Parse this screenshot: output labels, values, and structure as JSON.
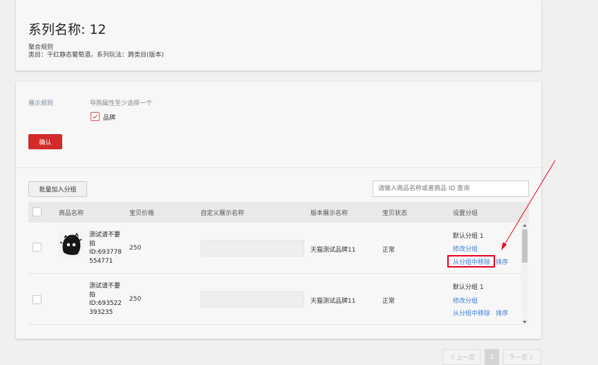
{
  "header": {
    "title": "系列名称: 12",
    "rule_title": "聚合规则",
    "rule_desc": "类目：干红静态葡萄酒，系列玩法：跨类目(版本)"
  },
  "display_rules": {
    "label": "展示规则",
    "hint": "导购属性至少选择一个",
    "brand_option": "品牌",
    "brand_checked": true,
    "confirm_label": "确认"
  },
  "toolbar": {
    "batch_add_label": "批量加入分组",
    "search_placeholder": "请输入商品名称或者商品 ID 查询"
  },
  "table": {
    "headers": [
      "商品名称",
      "宝贝价格",
      "自定义展示名称",
      "版本展示名称",
      "宝贝状态",
      "设置分组"
    ],
    "rows": [
      {
        "name": "测试请不要拍",
        "id": "ID:693778554771",
        "price": "250",
        "custom_name": "",
        "version_name": "天猫测试品牌11",
        "status": "正常",
        "group": "默认分组 1",
        "edit_group": "修改分组",
        "remove_group": "从分组中移除",
        "sort": "排序",
        "has_image": true
      },
      {
        "name": "测试请不要拍",
        "id": "ID:693522393235",
        "price": "250",
        "custom_name": "",
        "version_name": "天猫测试品牌11",
        "status": "正常",
        "group": "默认分组 1",
        "edit_group": "修改分组",
        "remove_group": "从分组中移除",
        "sort": "排序",
        "has_image": false
      }
    ]
  },
  "pagination": {
    "prev_label": "〈 上一页",
    "current_page": "1",
    "next_label": "下一页 〉"
  },
  "colors": {
    "accent_red": "#d32a2a",
    "link_blue": "#3b7ed8",
    "annotation_red": "#e8001c"
  }
}
